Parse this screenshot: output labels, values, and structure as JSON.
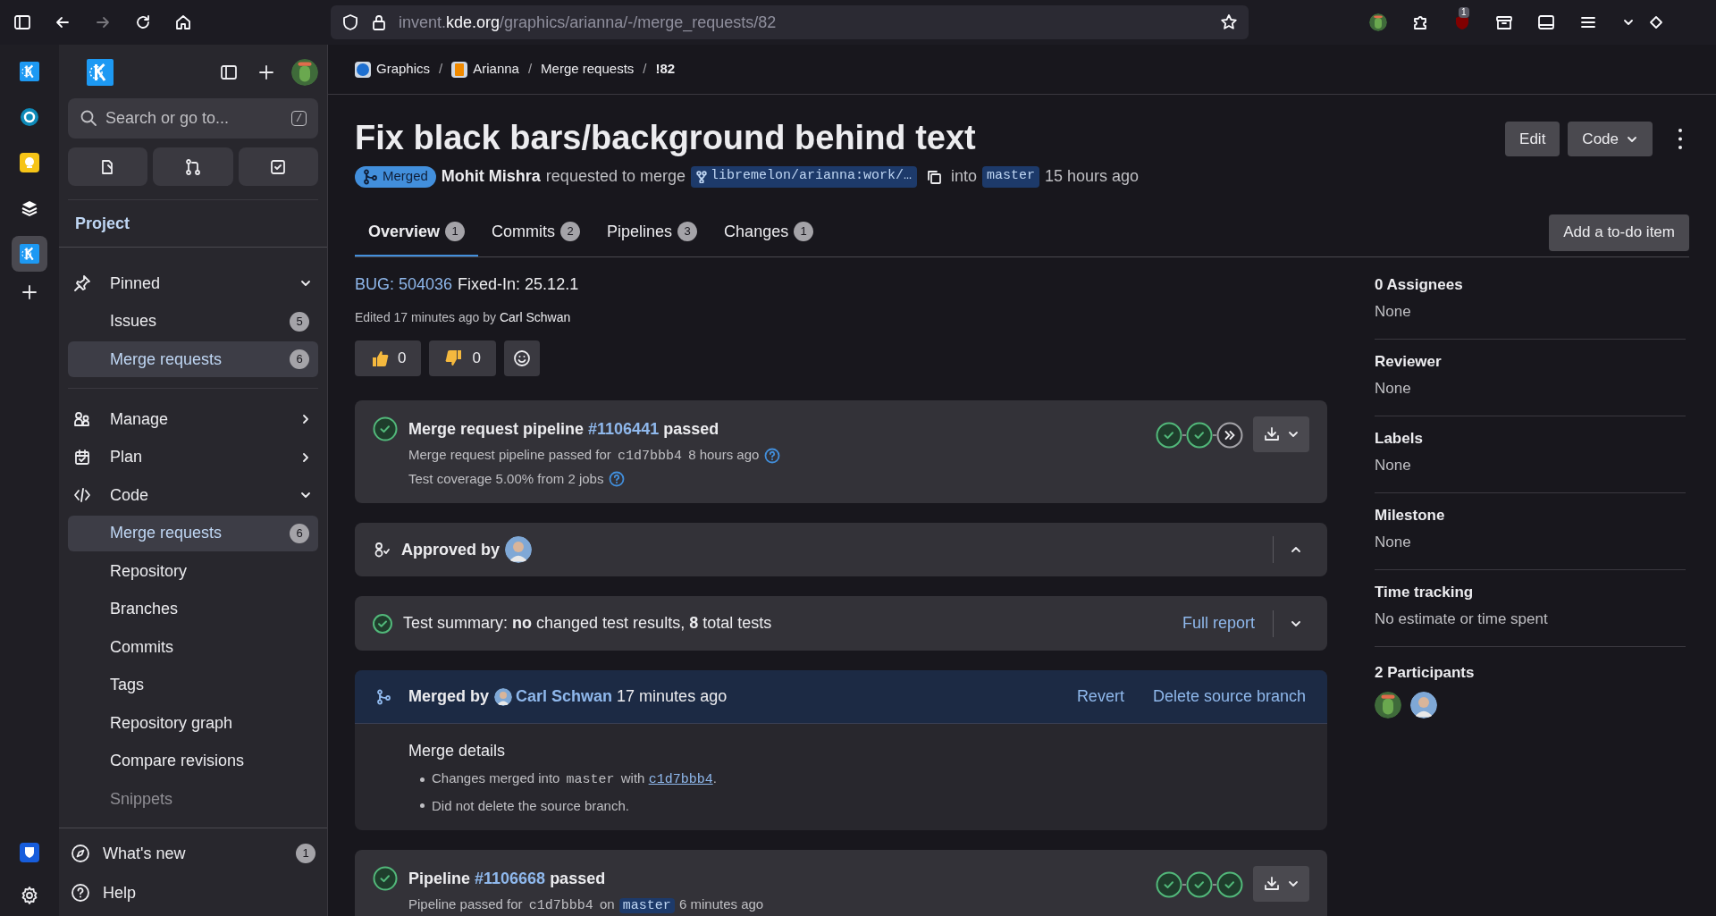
{
  "browser": {
    "url_prefix": "invent.",
    "url_domain": "kde.org",
    "url_path": "/graphics/arianna/-/merge_requests/82",
    "extension_badge": "1"
  },
  "rail": [
    {
      "kind": "kde",
      "selected": false
    },
    {
      "kind": "ring",
      "selected": false
    },
    {
      "kind": "bulb",
      "selected": false
    },
    {
      "kind": "layers",
      "selected": false
    },
    {
      "kind": "kde",
      "selected": true
    }
  ],
  "sidebar": {
    "search_placeholder": "Search or go to...",
    "search_shortcut": "/",
    "section": "Project",
    "groups": [
      {
        "label": "Pinned",
        "kind": "pin",
        "expanded": true,
        "items": [
          {
            "label": "Issues",
            "count": "5",
            "selected": false
          },
          {
            "label": "Merge requests",
            "count": "6",
            "selected": true
          }
        ]
      },
      {
        "label": "Manage",
        "kind": "manage",
        "expanded": false
      },
      {
        "label": "Plan",
        "kind": "plan",
        "expanded": false
      },
      {
        "label": "Code",
        "kind": "code",
        "expanded": true,
        "items": [
          {
            "label": "Merge requests",
            "count": "6",
            "selected": true
          },
          {
            "label": "Repository",
            "selected": false
          },
          {
            "label": "Branches",
            "selected": false
          },
          {
            "label": "Commits",
            "selected": false
          },
          {
            "label": "Tags",
            "selected": false
          },
          {
            "label": "Repository graph",
            "selected": false
          },
          {
            "label": "Compare revisions",
            "selected": false
          },
          {
            "label": "Snippets",
            "selected": false
          }
        ]
      }
    ],
    "footer": [
      {
        "label": "What's new",
        "kind": "whats-new",
        "count": "1"
      },
      {
        "label": "Help",
        "kind": "help"
      }
    ]
  },
  "merge_request": {
    "breadcrumbs": [
      {
        "label": "Graphics",
        "kind": "group"
      },
      {
        "label": "Arianna",
        "kind": "project",
        "separator": "/"
      },
      {
        "label": "Merge requests",
        "kind": "page",
        "separator": "/"
      },
      {
        "label": "!82",
        "kind": "current",
        "separator": "/"
      }
    ],
    "title": "Fix black bars/background behind text",
    "status": "Merged",
    "author": "Mohit Mishra",
    "action": "requested to merge",
    "source_branch": "libremelon/arianna:work/…",
    "into": "into",
    "target_branch": "master",
    "time": "15 hours ago",
    "actions": [
      {
        "label": "Edit",
        "kind": "button"
      },
      {
        "label": "Code",
        "kind": "dropdown"
      }
    ],
    "tabs": [
      {
        "label": "Overview",
        "count": "1",
        "selected": true
      },
      {
        "label": "Commits",
        "count": "2",
        "selected": false
      },
      {
        "label": "Pipelines",
        "count": "3",
        "selected": false
      },
      {
        "label": "Changes",
        "count": "1",
        "selected": false
      }
    ],
    "todo_button": "Add a to-do item"
  },
  "description": {
    "link": "BUG: 504036",
    "text": "Fixed-In: 25.12.1"
  },
  "edited": {
    "text": "Edited 17 minutes ago by ",
    "author": "Carl Schwan"
  },
  "reactions": [
    {
      "kind": "thumbs-up",
      "count": "0"
    },
    {
      "kind": "thumbs-down",
      "count": "0"
    }
  ],
  "widgets": [
    {
      "kind": "pipeline",
      "title_before": "Merge request pipeline ",
      "pipeline_id": "#1106441",
      "title_after": " passed",
      "details": [
        {
          "kind": "text",
          "text": "Merge request pipeline passed for "
        },
        {
          "kind": "code",
          "text": "c1d7bbb4"
        },
        {
          "kind": "text",
          "text": " 8 hours ago"
        }
      ],
      "coverage": "Test coverage 5.00% from 2 jobs",
      "stages": [
        {
          "kind": "passed"
        },
        {
          "kind": "passed"
        },
        {
          "kind": "skipped"
        }
      ]
    },
    {
      "kind": "approvals",
      "title": "Approved by",
      "expanded": true
    },
    {
      "kind": "test_summary",
      "summary": "Test summary: **no** changed test results, **8** total tests",
      "link": "Full report",
      "expanded": false
    },
    {
      "kind": "merged",
      "label": "Merged by",
      "user": "Carl Schwan",
      "time": "17 minutes ago",
      "actions": [
        "Revert",
        "Delete source branch"
      ],
      "details_title": "Merge details",
      "bullets": [
        [
          {
            "kind": "text",
            "text": "Changes merged into "
          },
          {
            "kind": "code",
            "text": "master"
          },
          {
            "kind": "text",
            "text": " with "
          },
          {
            "kind": "link",
            "text": "c1d7bbb4"
          },
          {
            "kind": "text",
            "text": "."
          }
        ],
        [
          {
            "kind": "text",
            "text": "Did not delete the source branch."
          }
        ]
      ]
    },
    {
      "kind": "pipeline",
      "title_before": "Pipeline ",
      "pipeline_id": "#1106668",
      "title_after": " passed",
      "details": [
        {
          "kind": "text",
          "text": "Pipeline passed for "
        },
        {
          "kind": "code",
          "text": "c1d7bbb4"
        },
        {
          "kind": "text",
          "text": " on "
        },
        {
          "kind": "branch",
          "text": "master"
        },
        {
          "kind": "text",
          "text": " 6 minutes ago"
        }
      ],
      "stages": [
        {
          "kind": "passed"
        },
        {
          "kind": "passed"
        },
        {
          "kind": "passed"
        }
      ]
    }
  ],
  "sidebar_right": [
    {
      "title": "0 Assignees",
      "value": "None"
    },
    {
      "title": "Reviewer",
      "value": "None"
    },
    {
      "title": "Labels",
      "value": "None"
    },
    {
      "title": "Milestone",
      "value": "None"
    },
    {
      "title": "Time tracking",
      "value": "No estimate or time spent"
    }
  ],
  "participants": {
    "title": "2 Participants",
    "avatars": [
      {
        "kind": "cactus"
      },
      {
        "kind": "person"
      }
    ]
  }
}
